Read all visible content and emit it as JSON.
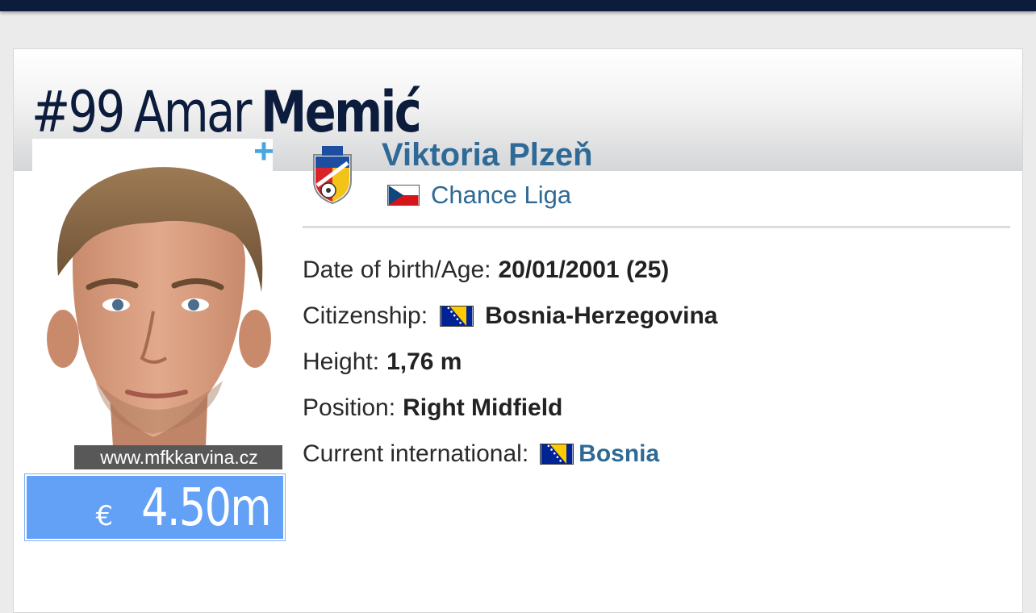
{
  "player": {
    "number": "#99",
    "first_name": "Amar",
    "last_name": "Memić",
    "photo_credit": "www.mfkkarvina.cz",
    "market_value_currency": "€",
    "market_value_amount": "4.50m"
  },
  "club": {
    "name": "Viktoria Plzeň",
    "league": "Chance Liga",
    "league_flag_icon": "czech-flag-icon",
    "logo_icon": "viktoria-plzen-crest-icon"
  },
  "details": {
    "dob_label": "Date of birth/Age:",
    "dob_value": "20/01/2001 (25)",
    "citizenship_label": "Citizenship:",
    "citizenship_value": "Bosnia-Herzegovina",
    "height_label": "Height:",
    "height_value": "1,76 m",
    "position_label": "Position:",
    "position_value": "Right Midfield",
    "international_label": "Current international:",
    "international_value": "Bosnia"
  },
  "actions": {
    "plus_label": "+"
  },
  "colors": {
    "navy": "#0c1c3c",
    "link_blue": "#2e6a95",
    "value_blue": "#63a1f7",
    "plus_blue": "#4aa6e0"
  }
}
